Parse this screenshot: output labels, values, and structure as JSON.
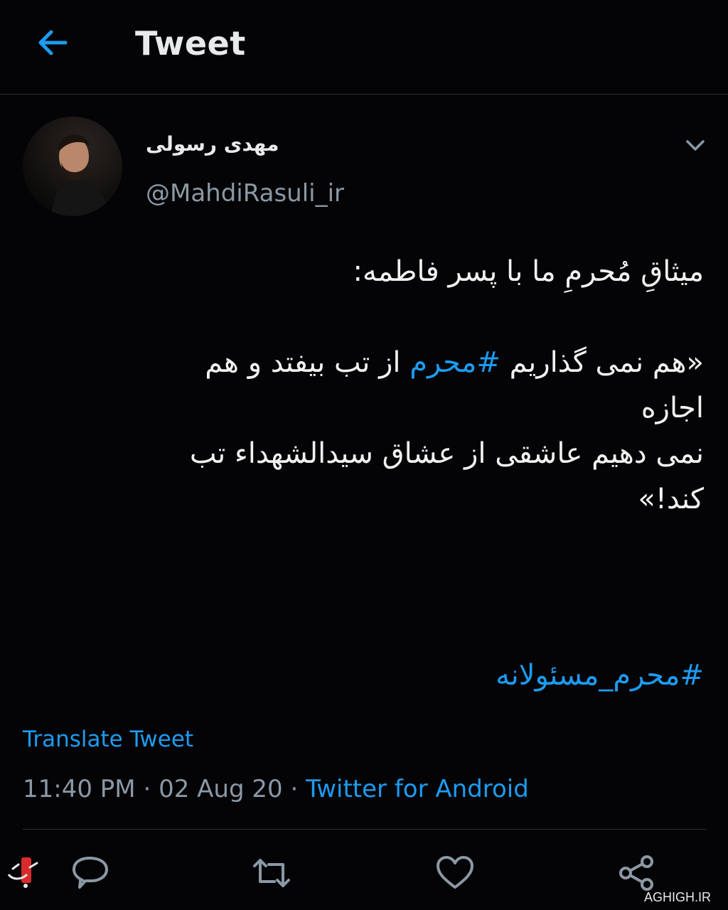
{
  "header": {
    "title": "Tweet",
    "back_icon": "arrow-left-icon"
  },
  "author": {
    "display_name": "مهدی رسولی",
    "handle": "@MahdiRasuli_ir"
  },
  "tweet": {
    "lines": [
      "میثاقِ مُحرمِ ما با پسر فاطمه:",
      "«هم نمی گذاریم",
      "#محرم",
      "از تب بیفتد و هم",
      "اجازه",
      "نمی دهیم عاشقی از عشاق سیدالشهداء تب",
      "کند!»"
    ],
    "closing_hashtag": "#محرم_مسئولانه"
  },
  "translate_label": "Translate Tweet",
  "meta": {
    "time": "11:40 PM",
    "date": "02 Aug 20",
    "separator": "·",
    "source": "Twitter for Android"
  },
  "actions": [
    "reply-icon",
    "retweet-icon",
    "like-icon",
    "share-icon"
  ],
  "watermark": {
    "text": "AGHIGH.IR"
  },
  "colors": {
    "accent": "#1d9bf0",
    "background": "#040406",
    "muted": "#8b98a5"
  }
}
